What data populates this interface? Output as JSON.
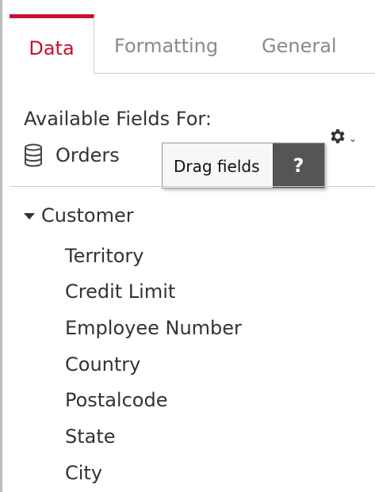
{
  "tabs": [
    {
      "label": "Data",
      "active": true
    },
    {
      "label": "Formatting",
      "active": false
    },
    {
      "label": "General",
      "active": false
    }
  ],
  "fields_panel": {
    "available_label": "Available Fields For:",
    "source_icon": "database-icon",
    "source_name": "Orders",
    "settings_icon": "gear-icon"
  },
  "tooltip": {
    "text": "Drag fields",
    "help_label": "?"
  },
  "tree": {
    "parent_label": "Customer",
    "children": [
      "Territory",
      "Credit Limit",
      "Employee Number",
      "Country",
      "Postalcode",
      "State",
      "City"
    ]
  },
  "colors": {
    "accent": "#c8102e",
    "tab_inactive": "#8a8a8a",
    "help_bg": "#555555"
  }
}
